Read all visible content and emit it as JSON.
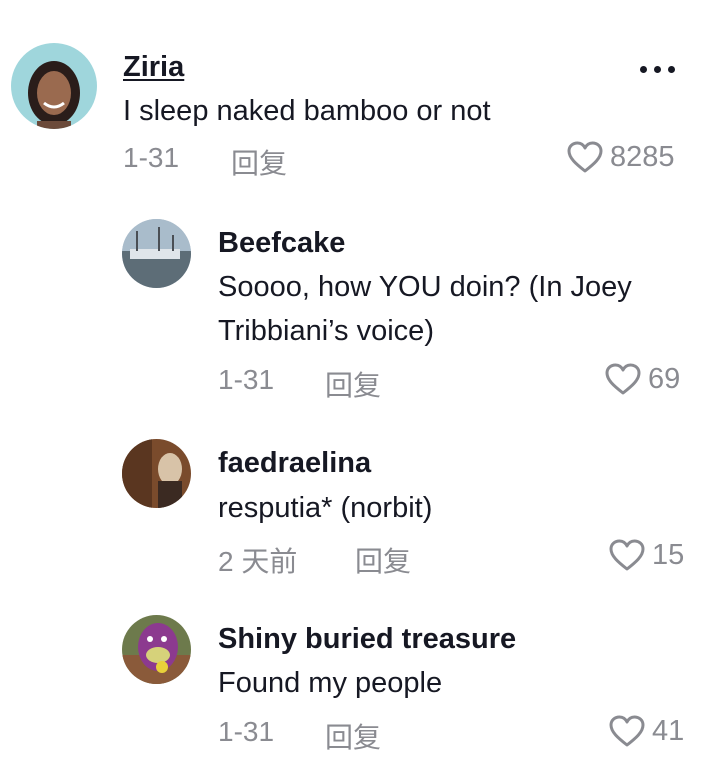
{
  "comments": [
    {
      "username": "Ziria",
      "text": "I sleep naked bamboo or not",
      "date": "1-31",
      "reply_label": "回复",
      "likes": "8285"
    },
    {
      "username": "Beefcake",
      "text": "Soooo, how YOU doin? (In Joey Tribbiani’s voice)",
      "date": "1-31",
      "reply_label": "回复",
      "likes": "69"
    },
    {
      "username": "faedraelina",
      "text": "resputia* (norbit)",
      "date": "2 天前",
      "reply_label": "回复",
      "likes": "15"
    },
    {
      "username": "Shiny buried treasure",
      "text": "Found my people",
      "date": "1-31",
      "reply_label": "回复",
      "likes": "41"
    }
  ],
  "colors": {
    "text": "#161823",
    "secondary": "#8a8b91",
    "background": "#ffffff"
  },
  "icons": [
    "more-icon",
    "heart-icon"
  ]
}
